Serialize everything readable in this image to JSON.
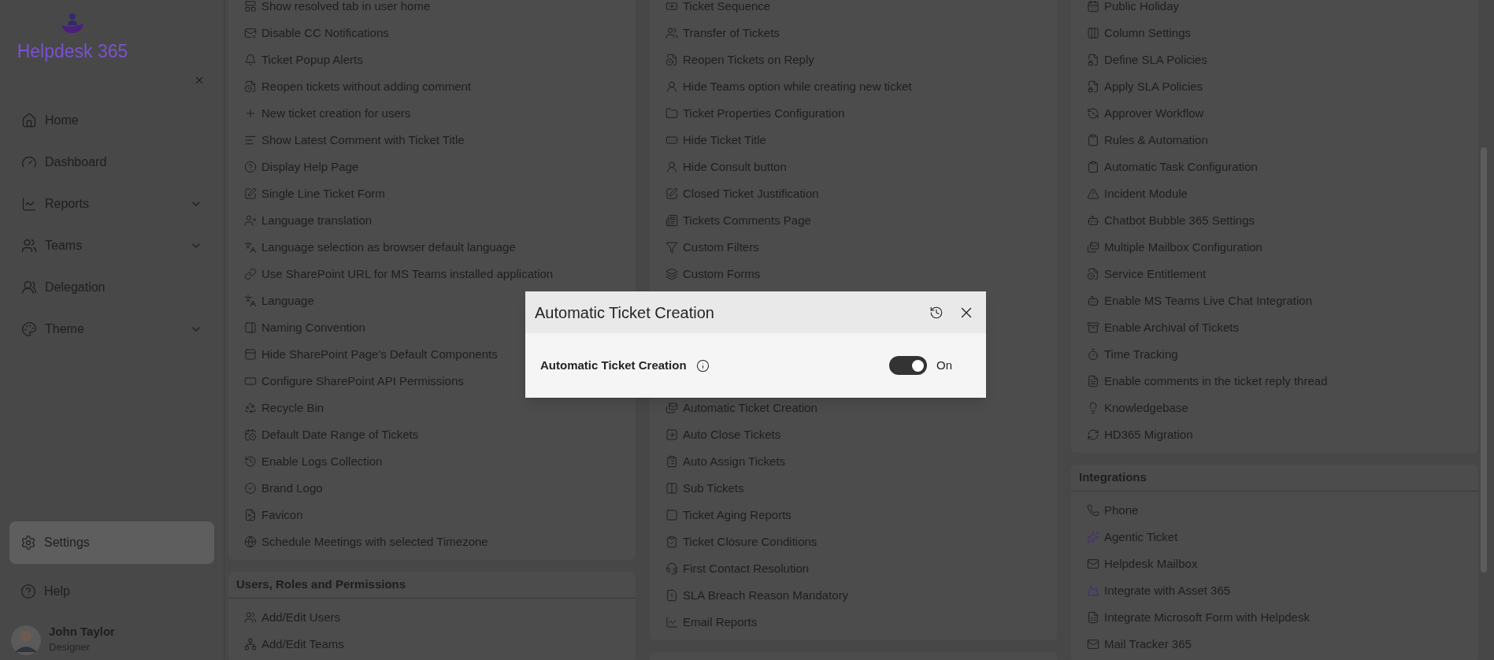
{
  "sidebar": {
    "logo_text": "Helpdesk 365",
    "items": [
      {
        "label": "Home",
        "kind": "link",
        "selected": false
      },
      {
        "label": "Dashboard",
        "kind": "link",
        "selected": false
      },
      {
        "label": "Reports",
        "kind": "group",
        "selected": false
      },
      {
        "label": "Teams",
        "kind": "group",
        "selected": false
      },
      {
        "label": "Delegation",
        "kind": "link",
        "selected": false
      },
      {
        "label": "Theme",
        "kind": "group",
        "selected": false
      }
    ],
    "bottom_items": [
      {
        "label": "Settings",
        "selected": true
      },
      {
        "label": "Help",
        "selected": false
      }
    ],
    "user": {
      "name": "John Taylor",
      "role": "Designer"
    }
  },
  "columns": [
    {
      "cards": [
        {
          "items": [
            "Show resolved tab in user home",
            "Disable CC Notifications",
            "Ticket Popup Alerts",
            "Reopen tickets without adding comment",
            "New ticket creation for users",
            "Show Latest Comment with Ticket Title",
            "Display Help Page",
            "Single Line Ticket Form",
            "Language translation",
            "Language selection as browser default language",
            "Use SharePoint URL for MS Teams installed application",
            "Language",
            "Naming Convention",
            "Hide SharePoint Page's Default Components",
            "Configure SharePoint API Permissions",
            "Recycle Bin",
            "Default Date Range of Tickets",
            "Enable Logs Collection",
            "Brand Logo",
            "Favicon",
            "Schedule Meetings with selected Timezone"
          ]
        },
        {
          "title": "Users, Roles and Permissions",
          "items": [
            "Add/Edit Users",
            "Add/Edit Teams"
          ]
        }
      ]
    },
    {
      "cards": [
        {
          "items": [
            "Ticket Sequence",
            "Transfer of Tickets",
            "Reopen Tickets on Reply",
            "Hide Teams option while creating new ticket",
            "Ticket Properties Configuration",
            "Hide Ticket Title",
            "Hide Consult button",
            "Closed Ticket Justification",
            "Tickets Comments Page",
            "Custom Filters",
            "Custom Forms"
          ],
          "items_below_dialog": [
            "Automatic Ticket Creation",
            "Auto Close Tickets",
            "Auto Assign Tickets",
            "Sub Tickets",
            "Ticket Aging Reports",
            "Ticket Closure Conditions",
            "First Contact Resolution",
            "SLA Breach Reason Mandatory",
            "Email Reports"
          ]
        }
      ]
    },
    {
      "cards": [
        {
          "items": [
            "Public Holiday",
            "Column Settings",
            "Define SLA Policies",
            "Apply SLA Policies",
            "Approver Workflow",
            "Rules & Automation",
            "Automatic Task Configuration",
            "Incident Module",
            "Chatbot Bubble 365 Settings",
            "Multiple Mailbox Configuration",
            "Service Entitlement",
            "Enable MS Teams Live Chat Integration",
            "Enable Archival of Tickets",
            "Time Tracking",
            "Enable comments in the ticket reply thread",
            "Knowledgebase",
            "HD365 Migration"
          ]
        },
        {
          "title": "Integrations",
          "items": [
            "Phone",
            "Agentic Ticket",
            "Helpdesk Mailbox",
            "Integrate with Asset 365",
            "Integrate Microsoft Form with Helpdesk",
            "Mail Tracker 365"
          ]
        }
      ]
    }
  ],
  "dialog": {
    "title": "Automatic Ticket Creation",
    "setting": {
      "label": "Automatic Ticket Creation",
      "on": true,
      "state_text": "On"
    }
  }
}
